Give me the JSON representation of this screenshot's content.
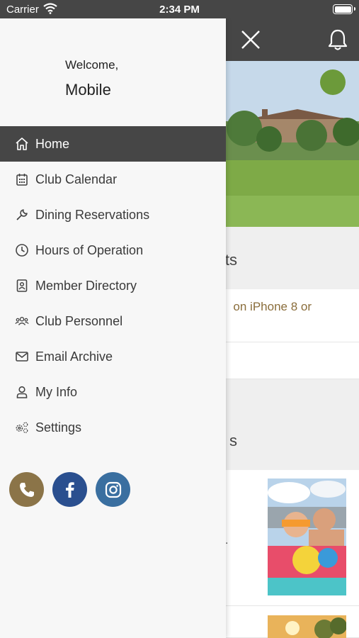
{
  "status_bar": {
    "carrier": "Carrier",
    "time": "2:34 PM"
  },
  "drawer": {
    "welcome": "Welcome,",
    "username": "Mobile",
    "menu": [
      {
        "label": "Home",
        "icon": "home-icon",
        "active": true
      },
      {
        "label": "Club Calendar",
        "icon": "calendar-icon"
      },
      {
        "label": "Dining Reservations",
        "icon": "wrench-icon"
      },
      {
        "label": "Hours of Operation",
        "icon": "clock-icon"
      },
      {
        "label": "Member Directory",
        "icon": "contact-book-icon"
      },
      {
        "label": "Club Personnel",
        "icon": "people-icon"
      },
      {
        "label": "Email Archive",
        "icon": "envelope-icon"
      },
      {
        "label": "My Info",
        "icon": "user-icon"
      },
      {
        "label": "Settings",
        "icon": "gears-icon"
      }
    ],
    "social": [
      {
        "name": "phone-icon",
        "color": "#8b7448"
      },
      {
        "name": "facebook-icon",
        "color": "#2a4f8f"
      },
      {
        "name": "instagram-icon",
        "color": "#3a6fa0"
      }
    ]
  },
  "background": {
    "section1_title_fragment": "ts",
    "row1_text_fragment": "on iPhone 8 or",
    "section2_title_fragment": "s",
    "row3_fragment": ".",
    "colors": {
      "header": "#464646",
      "accent_text": "#8a6d3b",
      "active_menu": "#464646"
    }
  }
}
